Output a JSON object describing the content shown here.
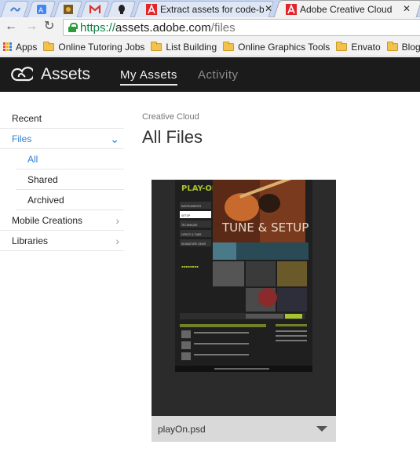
{
  "browser": {
    "tabs": [
      {
        "label": ""
      },
      {
        "label": ""
      },
      {
        "label": ""
      },
      {
        "label": ""
      },
      {
        "label": ""
      },
      {
        "label": "Extract assets for code-ba"
      },
      {
        "label": "Adobe Creative Cloud"
      }
    ],
    "url": {
      "protocol": "https://",
      "host": "assets.adobe.com",
      "path": "/files"
    },
    "bookmarks": [
      {
        "label": "Apps",
        "icon": "apps-grid-icon"
      },
      {
        "label": "Online Tutoring Jobs",
        "icon": "folder-icon"
      },
      {
        "label": "List Building",
        "icon": "folder-icon"
      },
      {
        "label": "Online Graphics Tools",
        "icon": "folder-icon"
      },
      {
        "label": "Envato",
        "icon": "folder-icon"
      },
      {
        "label": "Blogger G",
        "icon": "folder-icon"
      }
    ]
  },
  "header": {
    "brand": "Assets",
    "nav": [
      {
        "label": "My Assets",
        "active": true
      },
      {
        "label": "Activity",
        "active": false
      }
    ]
  },
  "sidebar": {
    "items": [
      {
        "label": "Recent"
      },
      {
        "label": "Files"
      },
      {
        "label": "All"
      },
      {
        "label": "Shared"
      },
      {
        "label": "Archived"
      },
      {
        "label": "Mobile Creations"
      },
      {
        "label": "Libraries"
      }
    ]
  },
  "main": {
    "breadcrumb": "Creative Cloud",
    "title": "All Files",
    "files": [
      {
        "name": "playOn.psd"
      }
    ]
  },
  "thumbnail": {
    "logo": "PLAY-ON",
    "headline": "TUNE & SETUP",
    "nav": [
      "INSTRUMENTS",
      "SETUP",
      "TECHNIQUE",
      "LYRICS & TABS",
      "SIGNATURE GEAR"
    ]
  },
  "colors": {
    "accent": "#2d7fd3",
    "header_bg": "#1b1b1b",
    "thumb_green": "#a8c330"
  }
}
